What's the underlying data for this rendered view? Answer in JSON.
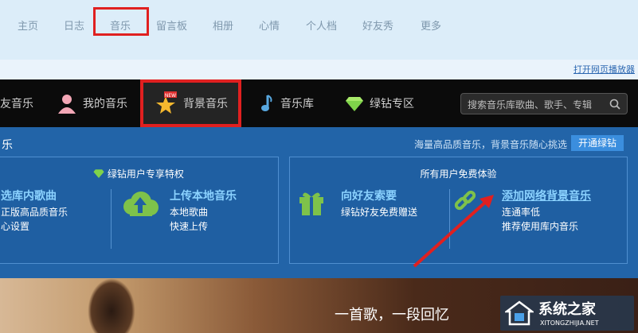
{
  "topnav": {
    "items": [
      "主页",
      "日志",
      "音乐",
      "留言板",
      "相册",
      "心情",
      "个人档",
      "好友秀",
      "更多"
    ]
  },
  "sub": {
    "player_link": "打开网页播放器"
  },
  "tabs": {
    "items": [
      "友音乐",
      "我的音乐",
      "背景音乐",
      "音乐库",
      "绿钻专区"
    ],
    "new_badge": "NEW"
  },
  "search": {
    "placeholder": "搜索音乐库歌曲、歌手、专辑"
  },
  "main": {
    "title": "乐",
    "promo": "海量高品质音乐，背景音乐随心挑选",
    "open_button": "开通绿钻",
    "panel1": {
      "header": "绿钻用户专享特权",
      "f1_title": "选库内歌曲",
      "f1_l1": "正版高品质音乐",
      "f1_l2": "心设置",
      "f2_title": "上传本地音乐",
      "f2_l1": "本地歌曲",
      "f2_l2": "快速上传"
    },
    "panel2": {
      "header": "所有用户免费体验",
      "f1_title": "向好友索要",
      "f1_l1": "绿钻好友免费赠送",
      "f2_title": "添加网络背景音乐",
      "f2_l1": "连通率低",
      "f2_l2": "推荐使用库内音乐"
    }
  },
  "banner": {
    "lyric": "一首歌，一段回忆"
  },
  "watermark": {
    "cn": "系统之家",
    "en": "XITONGZHIJIA.NET"
  },
  "colors": {
    "highlight": "#e02020",
    "link": "#8bd2ff",
    "main_bg": "#2264a8"
  }
}
